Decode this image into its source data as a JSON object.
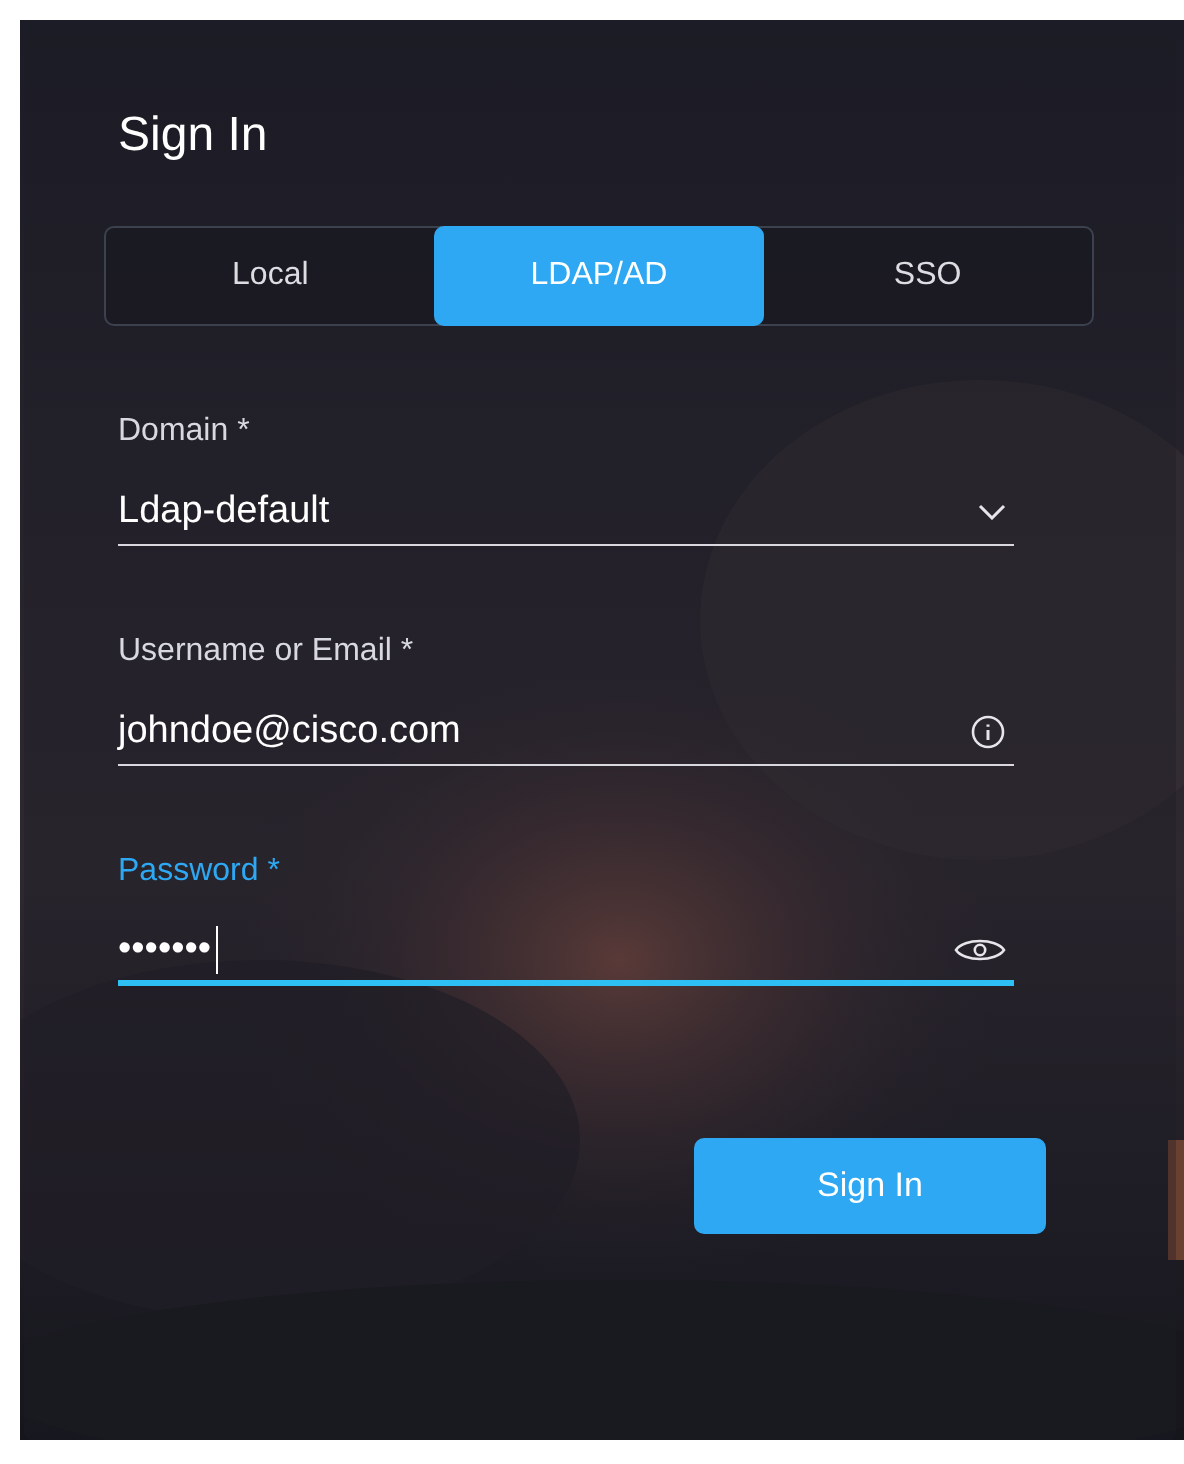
{
  "title": "Sign In",
  "tabs": [
    {
      "label": "Local",
      "selected": false
    },
    {
      "label": "LDAP/AD",
      "selected": true
    },
    {
      "label": "SSO",
      "selected": false
    }
  ],
  "fields": [
    {
      "kind": "select",
      "label": "Domain *",
      "value": "Ldap-default",
      "focused": false
    },
    {
      "kind": "text",
      "label": "Username or Email *",
      "value": "johndoe@cisco.com",
      "focused": false
    },
    {
      "kind": "password",
      "label": "Password *",
      "value": "•••••••",
      "focused": true
    }
  ],
  "button": "Sign In"
}
